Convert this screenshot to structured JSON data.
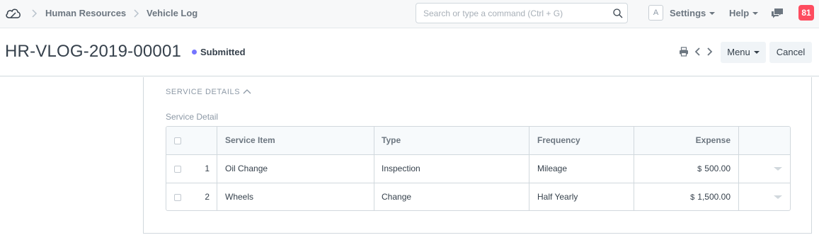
{
  "navbar": {
    "breadcrumbs": [
      "Human Resources",
      "Vehicle Log"
    ],
    "search_placeholder": "Search or type a command (Ctrl + G)",
    "avatar_initial": "A",
    "settings_label": "Settings",
    "help_label": "Help",
    "notification_count": "81"
  },
  "page": {
    "title": "HR-VLOG-2019-00001",
    "status": "Submitted",
    "status_color": "#7575ff",
    "menu_label": "Menu",
    "cancel_label": "Cancel"
  },
  "section": {
    "heading": "SERVICE DETAILS",
    "field_label": "Service Detail",
    "columns": [
      "Service Item",
      "Type",
      "Frequency",
      "Expense"
    ],
    "rows": [
      {
        "idx": "1",
        "item": "Oil Change",
        "type": "Inspection",
        "frequency": "Mileage",
        "currency": "$",
        "expense": "500.00"
      },
      {
        "idx": "2",
        "item": "Wheels",
        "type": "Change",
        "frequency": "Half Yearly",
        "currency": "$",
        "expense": "1,500.00"
      }
    ]
  },
  "icons": {
    "logo": "cloud-logo-icon",
    "search": "search-icon",
    "chat": "chat-icon",
    "print": "print-icon",
    "prev": "chevron-left-icon",
    "next": "chevron-right-icon",
    "collapse": "chevron-up-icon"
  }
}
